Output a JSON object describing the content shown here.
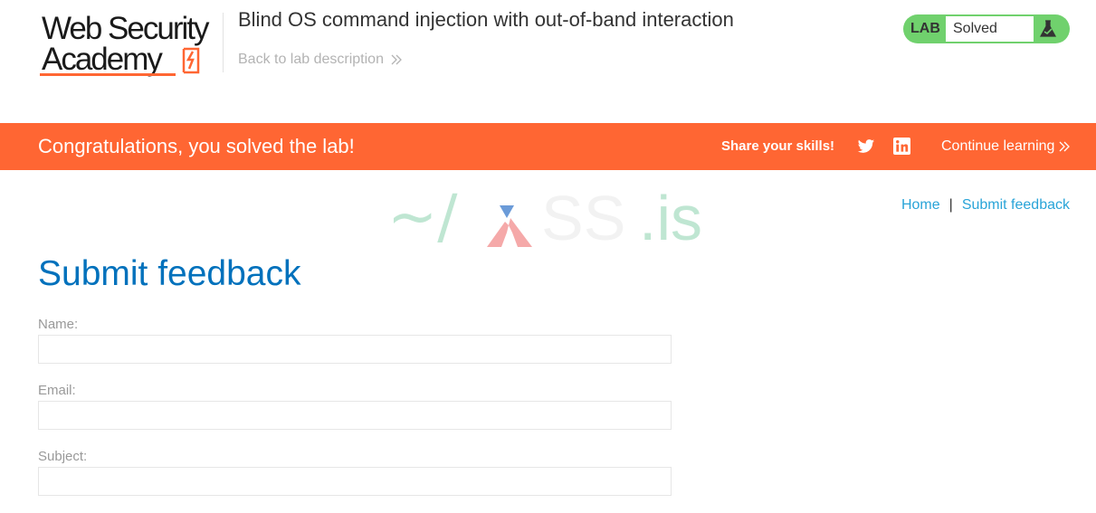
{
  "header": {
    "logo_line1": "Web Security",
    "logo_line2": "Academy",
    "lab_title": "Blind OS command injection with out-of-band interaction",
    "back_link": "Back to lab description"
  },
  "lab_status": {
    "badge": "LAB",
    "status": "Solved",
    "color": "#70d16d"
  },
  "banner": {
    "message": "Congratulations, you solved the lab!",
    "share_label": "Share your skills!",
    "continue_label": "Continue learning",
    "color": "#ff6633"
  },
  "watermark": {
    "prefix": "~/",
    "middle": "SS",
    "suffix": ".is"
  },
  "nav": {
    "home": "Home",
    "separator": "|",
    "submit_feedback": "Submit feedback"
  },
  "page": {
    "title": "Submit feedback"
  },
  "form": {
    "name_label": "Name:",
    "name_value": "",
    "email_label": "Email:",
    "email_value": "",
    "subject_label": "Subject:",
    "subject_value": ""
  },
  "icons": [
    "lightning-icon",
    "chevron-double-right-icon",
    "flask-icon",
    "twitter-icon",
    "linkedin-icon"
  ]
}
